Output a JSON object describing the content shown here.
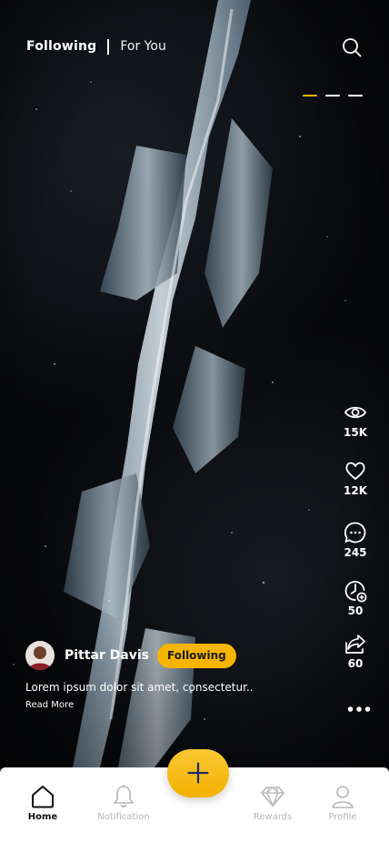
{
  "header": {
    "tabs": [
      {
        "label": "Following",
        "active": true
      },
      {
        "label": "For You",
        "active": false
      }
    ],
    "search_icon": "search-icon"
  },
  "story_progress": {
    "total_segments": 3,
    "active_segment": 1
  },
  "colors": {
    "accent": "#f7b500",
    "nav_background": "#ffffff",
    "nav_inactive": "#b5b5b5",
    "nav_active": "#111111"
  },
  "actions": [
    {
      "icon": "eye-icon",
      "count": "15K"
    },
    {
      "icon": "heart-icon",
      "count": "12K"
    },
    {
      "icon": "comment-icon",
      "count": "245"
    },
    {
      "icon": "clock-add-icon",
      "count": "50"
    },
    {
      "icon": "share-icon",
      "count": "60"
    }
  ],
  "post": {
    "author_name": "Pittar Davis",
    "follow_label": "Following",
    "caption": "Lorem ipsum dolor sit amet, consectetur..",
    "read_more": "Read More"
  },
  "bottom_nav": {
    "items": [
      {
        "label": "Home",
        "icon": "home-icon",
        "active": true
      },
      {
        "label": "Notification",
        "icon": "bell-icon",
        "active": false
      },
      {
        "label": "Rewards",
        "icon": "diamond-icon",
        "active": false
      },
      {
        "label": "Profile",
        "icon": "user-icon",
        "active": false
      }
    ],
    "fab_icon": "plus-icon"
  }
}
